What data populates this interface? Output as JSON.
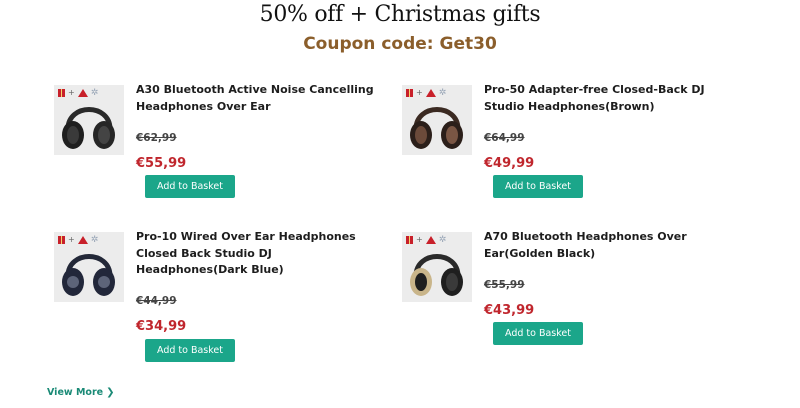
{
  "headline": "50% off + Christmas gifts",
  "coupon": "Coupon code: Get30",
  "colors": {
    "coupon": "#8b5e2b",
    "price": "#c0262d",
    "button": "#1ba68a",
    "link": "#1a8a76"
  },
  "products": [
    {
      "title": "A30 Bluetooth Active Noise Cancelling Headphones Over Ear",
      "old_price": "€62,99",
      "new_price": "€55,99",
      "button": "Add to Basket",
      "image": "headphones-black-a30"
    },
    {
      "title": "Pro-50 Adapter-free Closed-Back DJ Studio Headphones(Brown)",
      "old_price": "€64,99",
      "new_price": "€49,99",
      "button": "Add to Basket",
      "image": "headphones-brown-pro50"
    },
    {
      "title": "Pro-10 Wired Over Ear Headphones Closed Back Studio DJ Headphones(Dark Blue)",
      "old_price": "€44,99",
      "new_price": "€34,99",
      "button": "Add to Basket",
      "image": "headphones-darkblue-pro10"
    },
    {
      "title": "A70 Bluetooth Headphones Over Ear(Golden Black)",
      "old_price": "€55,99",
      "new_price": "€43,99",
      "button": "Add to Basket",
      "image": "headphones-golden-a70"
    }
  ],
  "view_more": "View More"
}
